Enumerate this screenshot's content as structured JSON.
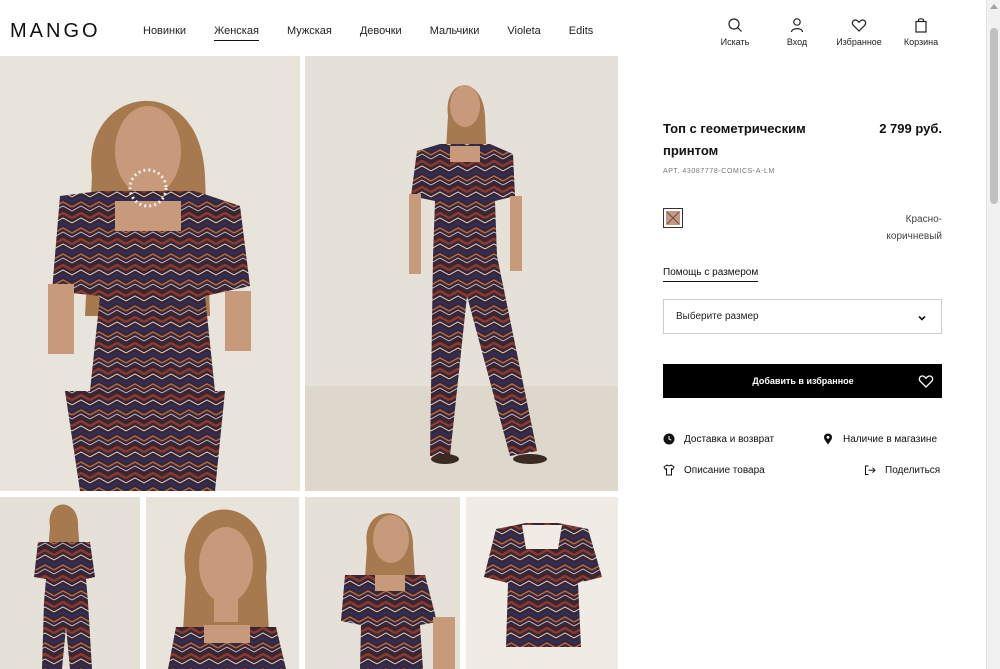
{
  "brand": {
    "logo": "MANGO"
  },
  "nav": {
    "items": [
      "Новинки",
      "Женская",
      "Мужская",
      "Девочки",
      "Мальчики",
      "Violeta",
      "Edits"
    ],
    "active": "Женская"
  },
  "header_actions": {
    "search": {
      "label": "Искать",
      "icon": "search-icon"
    },
    "login": {
      "label": "Вход",
      "icon": "user-icon"
    },
    "favorites": {
      "label": "Избранное",
      "icon": "heart-icon"
    },
    "cart": {
      "label": "Корзина",
      "icon": "shopping-bag-icon"
    }
  },
  "product": {
    "title": "Топ с геометрическим принтом",
    "price": "2 799 руб.",
    "ref": "АРТ. 43087778-COMICS-A-LM",
    "color_name": "Красно-коричневый",
    "swatch_color": "#c49a86",
    "size_help": "Помощь с размером",
    "size_placeholder": "Выберите размер",
    "add_button": "Добавить в избранное"
  },
  "links": {
    "delivery": "Доставка и возврат",
    "stores": "Наличие в магазине",
    "description": "Описание товара",
    "share": "Поделиться"
  },
  "colors": {
    "photo_background": "#e9e4dc",
    "knit_dark": "#3a2632",
    "knit_red": "#8a3a2e",
    "knit_navy": "#2e2f5c",
    "skin": "#c89a7c",
    "hair": "#a67a4e"
  }
}
